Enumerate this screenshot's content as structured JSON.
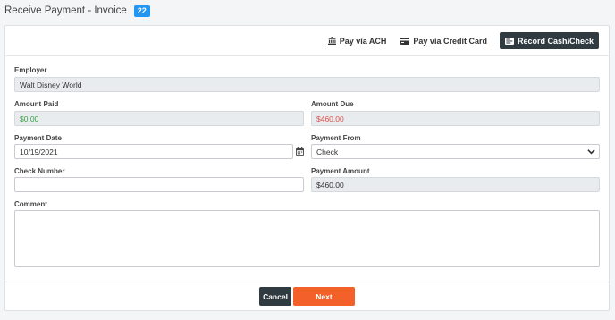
{
  "header": {
    "title": "Receive Payment - Invoice",
    "invoice_number": "22"
  },
  "toolbar": {
    "ach_label": "Pay via ACH",
    "card_label": "Pay via Credit Card",
    "cash_label": "Record Cash/Check"
  },
  "form": {
    "employer_label": "Employer",
    "employer_value": "Walt Disney World",
    "amount_paid_label": "Amount Paid",
    "amount_paid_value": "$0.00",
    "amount_due_label": "Amount Due",
    "amount_due_value": "$460.00",
    "payment_date_label": "Payment Date",
    "payment_date_value": "10/19/2021",
    "payment_from_label": "Payment From",
    "payment_from_value": "Check",
    "check_number_label": "Check Number",
    "check_number_value": "",
    "payment_amount_label": "Payment Amount",
    "payment_amount_value": "$460.00",
    "comment_label": "Comment",
    "comment_value": ""
  },
  "footer": {
    "cancel_label": "Cancel",
    "next_label": "Next"
  },
  "colors": {
    "badge": "#2196f3",
    "dark_button": "#2f3a41",
    "next_button": "#f3602a",
    "paid_green": "#3aa048",
    "due_red": "#d9534f"
  },
  "icons": {
    "ach": "bank-icon",
    "card": "credit-card-icon",
    "cash": "cash-icon",
    "date": "calendar-icon",
    "select": "chevron-down-icon"
  }
}
